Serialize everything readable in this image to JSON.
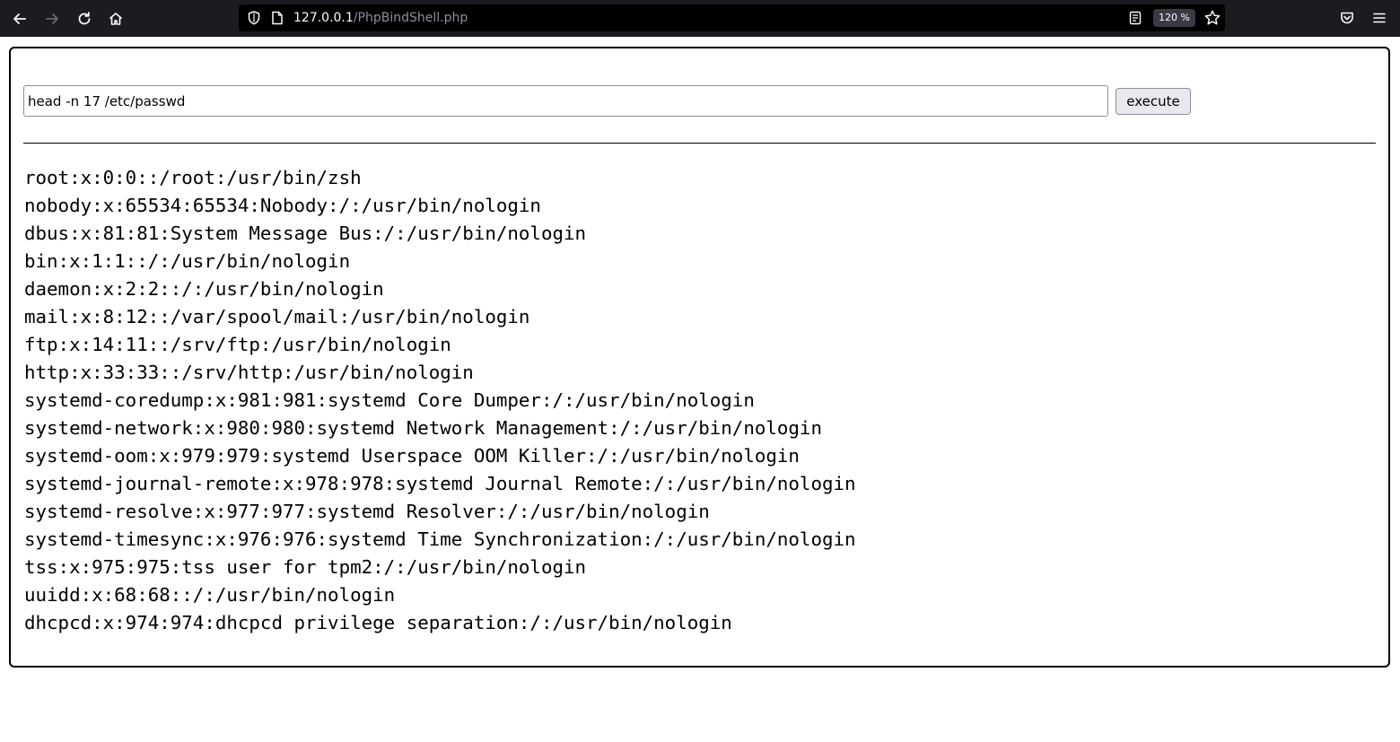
{
  "browser": {
    "url_host": "127.0.0.1",
    "url_path": "/PhpBindShell.php",
    "zoom": "120 %"
  },
  "form": {
    "command_value": "head -n 17 /etc/passwd",
    "execute_label": "execute"
  },
  "output": {
    "lines": [
      "root:x:0:0::/root:/usr/bin/zsh",
      "nobody:x:65534:65534:Nobody:/:/usr/bin/nologin",
      "dbus:x:81:81:System Message Bus:/:/usr/bin/nologin",
      "bin:x:1:1::/:/usr/bin/nologin",
      "daemon:x:2:2::/:/usr/bin/nologin",
      "mail:x:8:12::/var/spool/mail:/usr/bin/nologin",
      "ftp:x:14:11::/srv/ftp:/usr/bin/nologin",
      "http:x:33:33::/srv/http:/usr/bin/nologin",
      "systemd-coredump:x:981:981:systemd Core Dumper:/:/usr/bin/nologin",
      "systemd-network:x:980:980:systemd Network Management:/:/usr/bin/nologin",
      "systemd-oom:x:979:979:systemd Userspace OOM Killer:/:/usr/bin/nologin",
      "systemd-journal-remote:x:978:978:systemd Journal Remote:/:/usr/bin/nologin",
      "systemd-resolve:x:977:977:systemd Resolver:/:/usr/bin/nologin",
      "systemd-timesync:x:976:976:systemd Time Synchronization:/:/usr/bin/nologin",
      "tss:x:975:975:tss user for tpm2:/:/usr/bin/nologin",
      "uuidd:x:68:68::/:/usr/bin/nologin",
      "dhcpcd:x:974:974:dhcpcd privilege separation:/:/usr/bin/nologin"
    ]
  },
  "icons": {
    "back": "back-arrow-icon",
    "forward": "forward-arrow-icon",
    "reload": "reload-icon",
    "home": "home-icon",
    "tracking": "shield-icon",
    "page": "page-icon",
    "reader": "reader-view-icon",
    "bookmark": "star-icon",
    "pocket": "pocket-icon",
    "menu": "hamburger-menu-icon"
  }
}
